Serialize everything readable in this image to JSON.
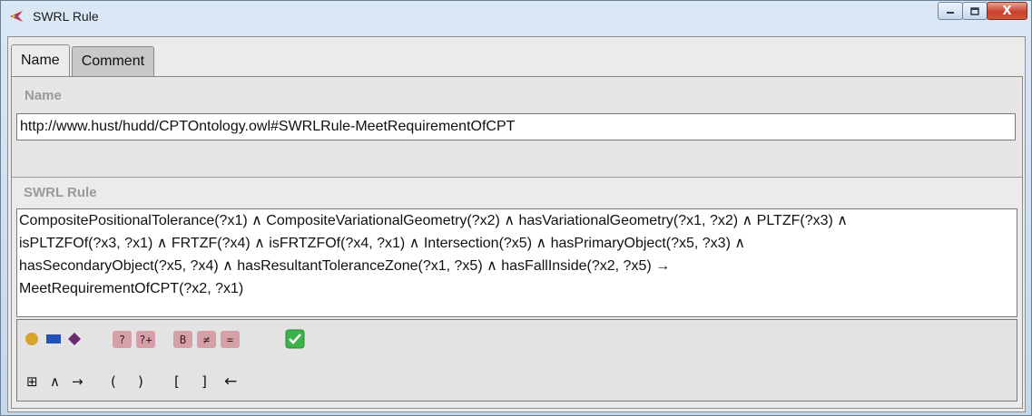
{
  "window": {
    "title": "SWRL Rule",
    "controls": {
      "minimize_icon": "minimize-icon",
      "maximize_icon": "maximize-icon",
      "close_label": "X"
    }
  },
  "tabs": [
    {
      "label": "Name",
      "active": true
    },
    {
      "label": "Comment",
      "active": false
    }
  ],
  "name_section": {
    "label": "Name",
    "value": "http://www.hust/hudd/CPTOntology.owl#SWRLRule-MeetRequirementOfCPT"
  },
  "rule_section": {
    "label": "SWRL Rule",
    "lines": [
      "CompositePositionalTolerance(?x1) ∧ CompositeVariationalGeometry(?x2) ∧ hasVariationalGeometry(?x1, ?x2) ∧ PLTZF(?x3) ∧",
      "isPLTZFOf(?x3, ?x1) ∧ FRTZF(?x4) ∧ isFRTZFOf(?x4, ?x1) ∧ Intersection(?x5) ∧ hasPrimaryObject(?x5, ?x3) ∧",
      "hasSecondaryObject(?x5, ?x4) ∧ hasResultantToleranceZone(?x1, ?x5) ∧ hasFallInside(?x2, ?x5) →",
      "MeetRequirementOfCPT(?x2, ?x1)"
    ]
  },
  "toolbar": {
    "row1": {
      "class_icon": "class-circle-icon",
      "property_icon": "property-rect-icon",
      "individual_icon": "individual-diamond-icon",
      "variable_icon": "variable-wand-icon",
      "add_variable_icon": "add-variable-icon",
      "builtin_label": "B",
      "different_label": "≠",
      "same_label": "=",
      "check_icon": "check-icon"
    },
    "row2": {
      "table_label": "⊞",
      "and_label": "∧",
      "implies_label": "→",
      "open_paren": "(",
      "close_paren": ")",
      "open_bracket": "[",
      "close_bracket": "]",
      "backspace_label": "←"
    }
  },
  "colors": {
    "class_circle": "#d4a52a",
    "property_rect": "#2351b8",
    "individual_diamond": "#6a2a6e",
    "builtin_button": "#d5a0a8",
    "check_green": "#3cb24b",
    "label_gray": "#9a9a9a"
  }
}
